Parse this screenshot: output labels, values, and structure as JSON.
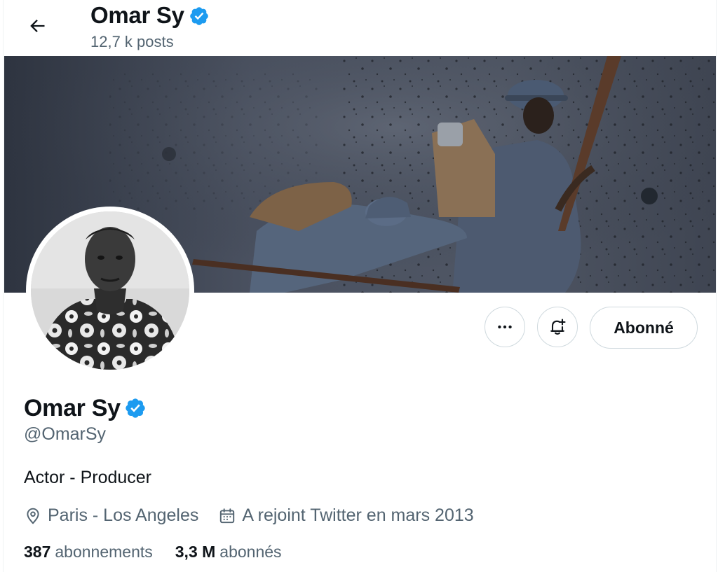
{
  "header": {
    "name": "Omar Sy",
    "posts_count": "12,7 k posts"
  },
  "banner": {
    "scene": "soldiers-in-battle-photo"
  },
  "avatar": {
    "scene": "portrait-photo-floral-shirt"
  },
  "actions": {
    "more_icon": "more-horizontal-icon",
    "notify_icon": "bell-plus-icon",
    "follow_label": "Abonné"
  },
  "profile": {
    "name": "Omar Sy",
    "handle": "@OmarSy",
    "bio": "Actor - Producer",
    "location": "Paris - Los Angeles",
    "joined": "A rejoint Twitter en mars 2013",
    "following_count": "387",
    "following_label": "abonnements",
    "followers_count": "3,3 M",
    "followers_label": "abonnés"
  },
  "colors": {
    "verified": "#1d9bf0",
    "text_primary": "#0f1419",
    "text_secondary": "#536471",
    "border": "#cfd9de"
  }
}
